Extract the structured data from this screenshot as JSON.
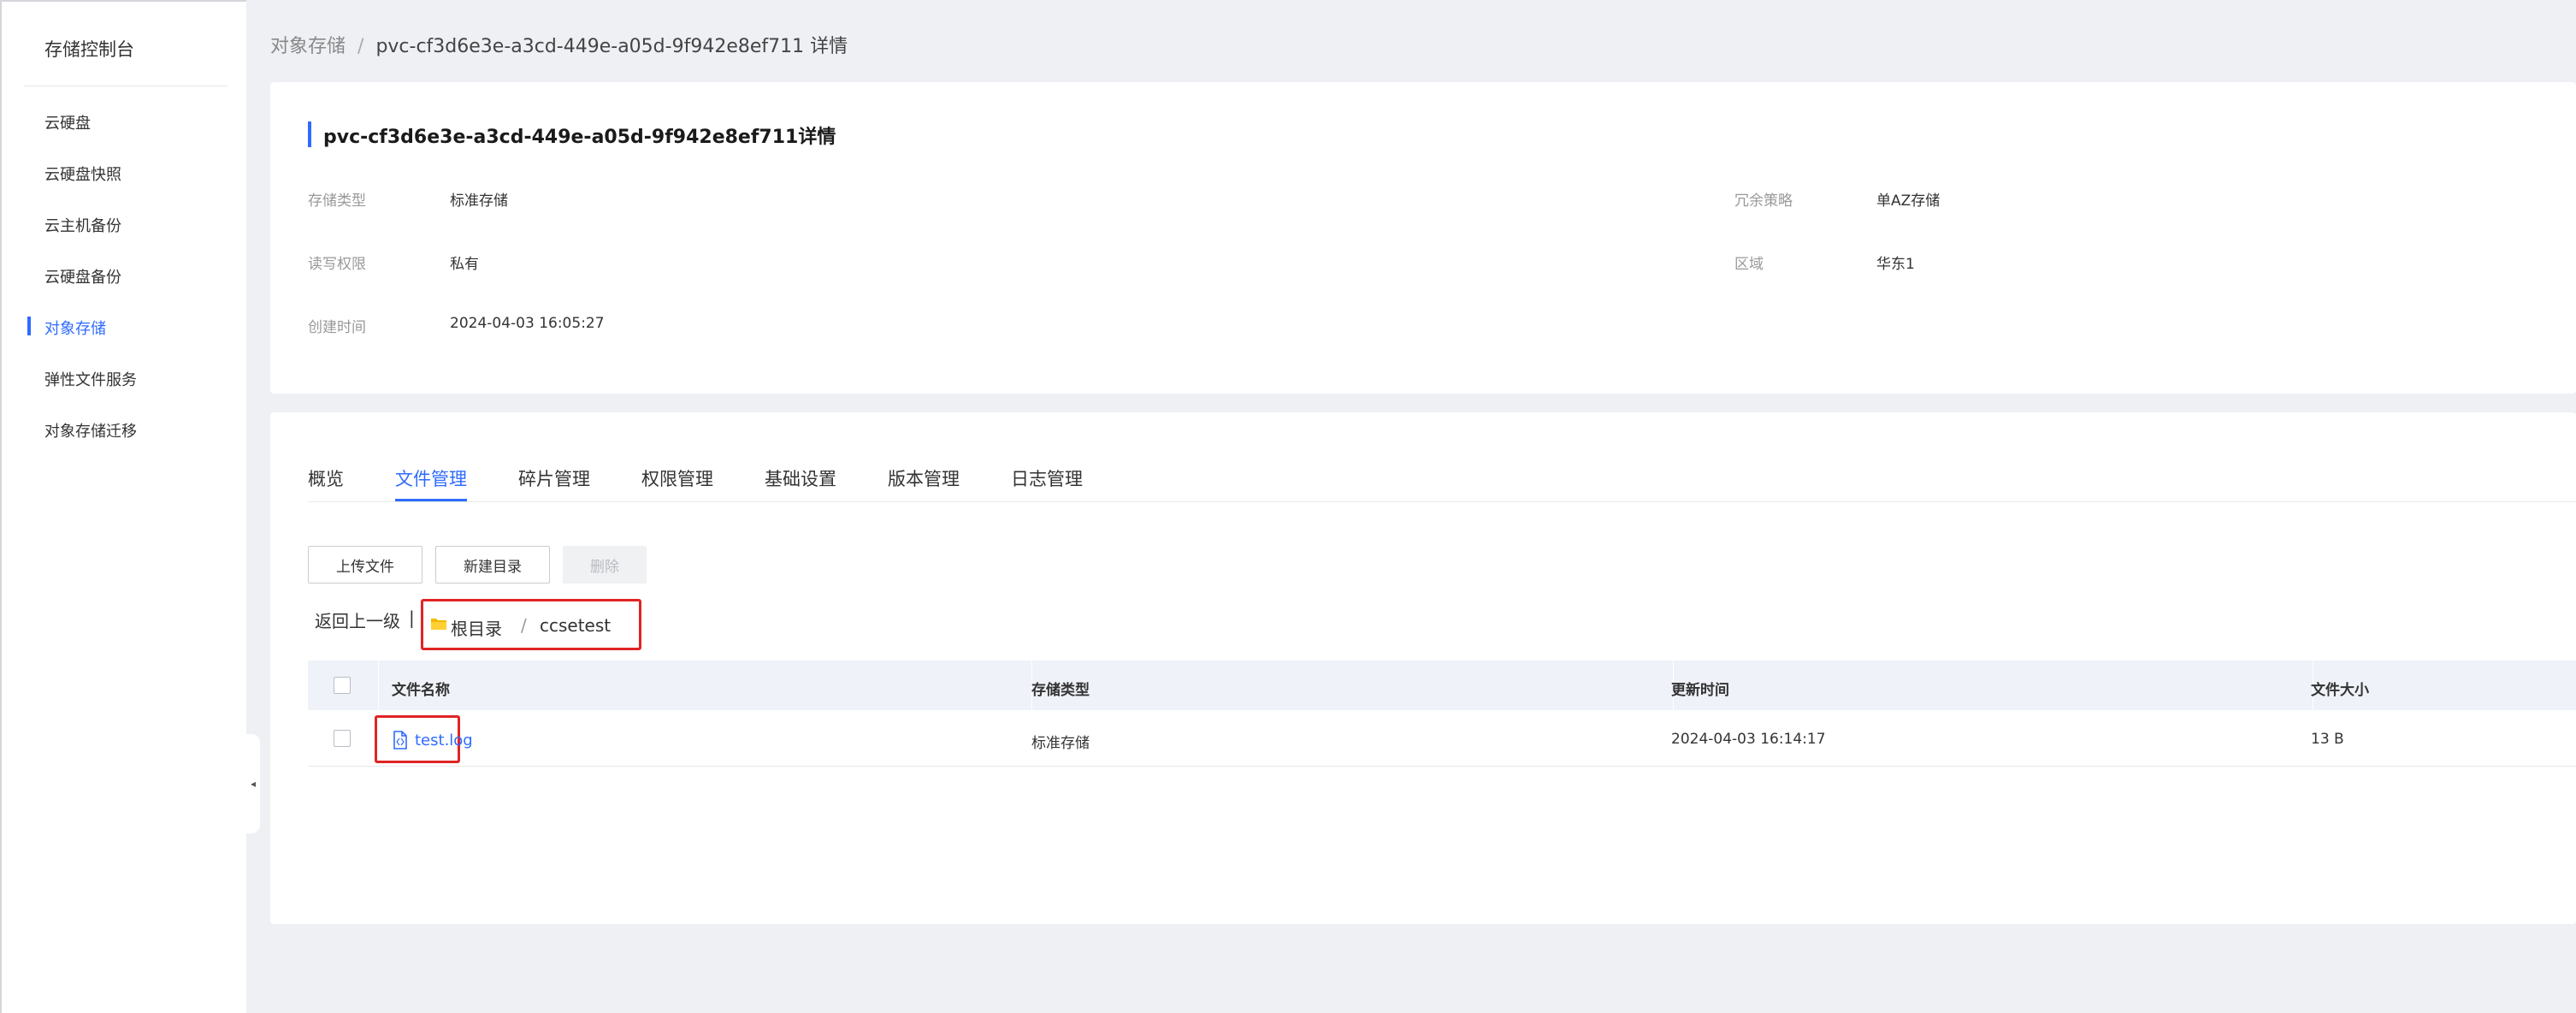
{
  "sidebar": {
    "title": "存储控制台",
    "items": [
      {
        "label": "云硬盘"
      },
      {
        "label": "云硬盘快照"
      },
      {
        "label": "云主机备份"
      },
      {
        "label": "云硬盘备份"
      },
      {
        "label": "对象存储"
      },
      {
        "label": "弹性文件服务"
      },
      {
        "label": "对象存储迁移"
      }
    ],
    "active_item": "对象存储",
    "collapse_icon": "◂"
  },
  "breadcrumb": {
    "parent": "对象存储",
    "separator": "/",
    "current": "pvc-cf3d6e3e-a3cd-449e-a05d-9f942e8ef711 详情"
  },
  "detail": {
    "title": "pvc-cf3d6e3e-a3cd-449e-a05d-9f942e8ef711详情",
    "fields": [
      {
        "label": "存储类型",
        "value": "标准存储"
      },
      {
        "label": "冗余策略",
        "value": "单AZ存储"
      },
      {
        "label": "读写权限",
        "value": "私有"
      },
      {
        "label": "区域",
        "value": "华东1"
      },
      {
        "label": "创建时间",
        "value": "2024-04-03 16:05:27"
      }
    ]
  },
  "tabs": [
    {
      "label": "概览"
    },
    {
      "label": "文件管理"
    },
    {
      "label": "碎片管理"
    },
    {
      "label": "权限管理"
    },
    {
      "label": "基础设置"
    },
    {
      "label": "版本管理"
    },
    {
      "label": "日志管理"
    }
  ],
  "active_tab": "文件管理",
  "toolbar": {
    "upload_label": "上传文件",
    "new_dir_label": "新建目录",
    "delete_label": "删除"
  },
  "path": {
    "back_label": "返回上一级",
    "back_separator": "|",
    "root_label": "根目录",
    "separator": "/",
    "current": "ccsetest"
  },
  "table": {
    "columns": [
      "文件名称",
      "存储类型",
      "更新时间",
      "文件大小"
    ],
    "rows": [
      {
        "name": "test.log",
        "storage_type": "标准存储",
        "updated": "2024-04-03 16:14:17",
        "size": "13 B"
      }
    ]
  },
  "colors": {
    "accent": "#2f6bff",
    "highlight_border": "#e02424",
    "folder": "#f5b800"
  }
}
